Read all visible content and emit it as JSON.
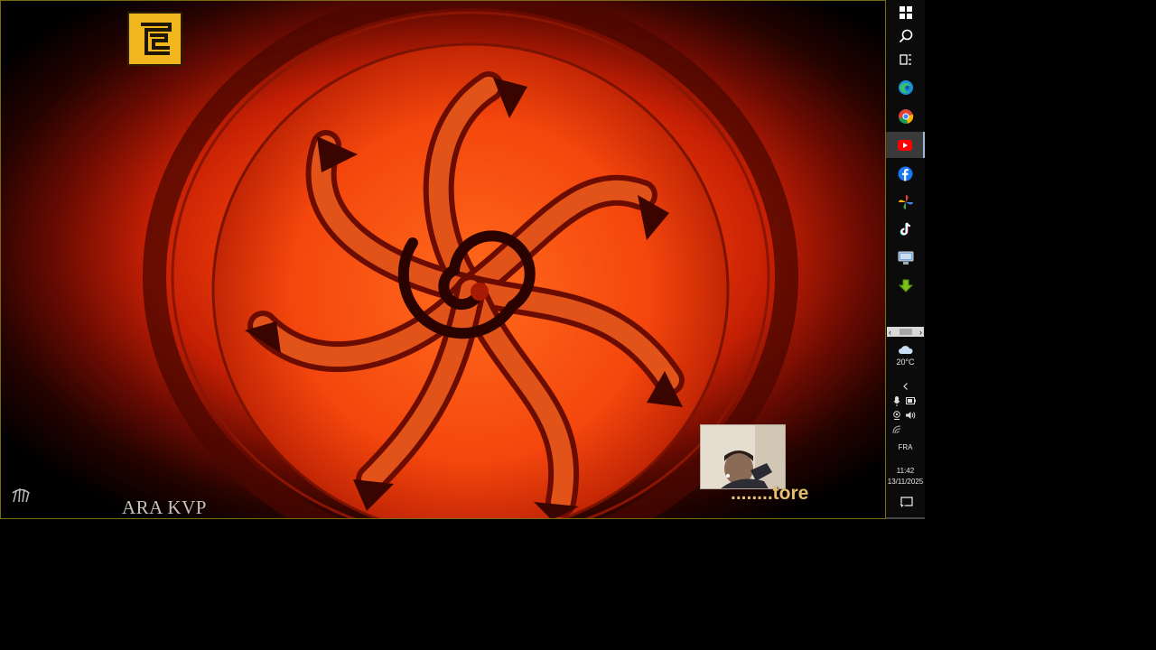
{
  "video": {
    "watermark": "ARA KVP",
    "pip_caption": "........tore"
  },
  "taskbar": {
    "apps": [
      {
        "name": "start",
        "icon": "windows-logo-icon"
      },
      {
        "name": "search",
        "icon": "search-icon"
      },
      {
        "name": "task-view",
        "icon": "task-view-icon"
      },
      {
        "name": "edge",
        "icon": "edge-icon"
      },
      {
        "name": "chrome",
        "icon": "chrome-icon"
      },
      {
        "name": "youtube",
        "icon": "youtube-icon",
        "active": true
      },
      {
        "name": "facebook",
        "icon": "facebook-icon"
      },
      {
        "name": "photos",
        "icon": "pinwheel-icon"
      },
      {
        "name": "tiktok",
        "icon": "tiktok-icon"
      },
      {
        "name": "remote-desktop",
        "icon": "monitor-icon"
      },
      {
        "name": "downloader",
        "icon": "green-download-icon"
      }
    ],
    "weather": {
      "temp": "20°C",
      "icon": "cloud-icon"
    },
    "language": "FRA",
    "clock": {
      "time": "11:42",
      "date": "13/11/2025"
    }
  },
  "colors": {
    "taskbar_bg": "#0b0b0b",
    "video_border": "#7a6a12",
    "logo_gold": "#f2b61e",
    "caption_gold": "#e7bf70"
  }
}
